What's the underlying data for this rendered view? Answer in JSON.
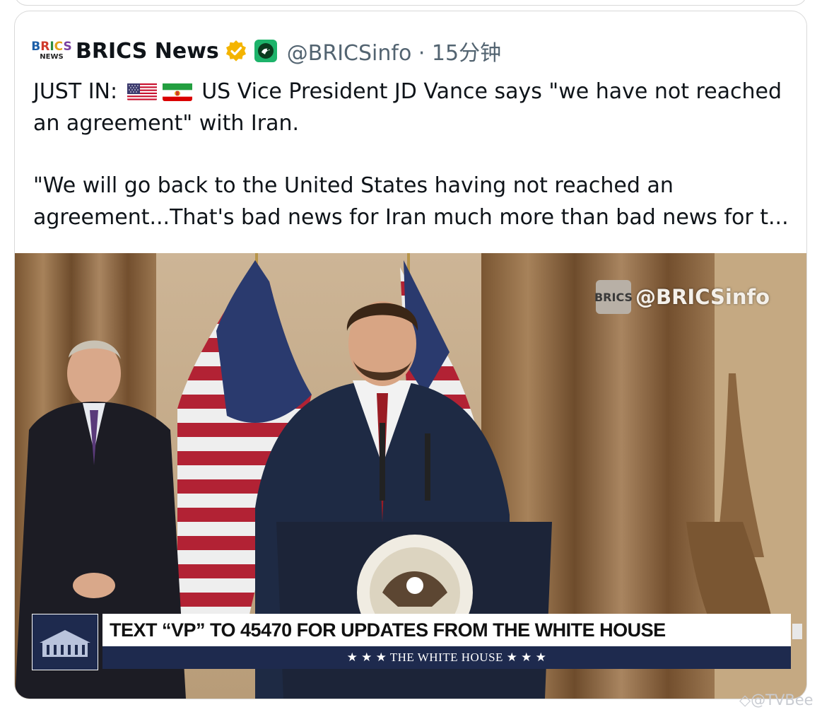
{
  "tweet": {
    "logo": {
      "line1": "BRICS",
      "line2": "NEWS"
    },
    "display_name": "BRICS News",
    "handle_time": "@BRICSinfo · 15分钟",
    "text_line1_prefix": "JUST IN:",
    "text_line1_suffix": "US Vice President JD Vance says \"we have not reached",
    "text_line2": "an agreement\" with Iran.",
    "text_line3": "\"We will go back to the United States having not reached an",
    "text_line4": "agreement...That's bad news for Iran much more than bad news for t..."
  },
  "media": {
    "watermark_logo": "BRICS",
    "watermark_handle": "@BRICSinfo",
    "lower_third_headline": "TEXT “VP” TO 45470 FOR UPDATES FROM THE WHITE HOUSE",
    "lower_third_sub": "★ ★ ★   THE WHITE HOUSE   ★ ★ ★"
  },
  "footer": {
    "watermark": "@TVBee"
  },
  "icons": [
    "verified-badge-icon",
    "affiliate-badge-icon",
    "us-flag-icon",
    "iran-flag-icon",
    "white-house-icon"
  ],
  "colors": {
    "text": "#0f1419",
    "secondary": "#536471",
    "border": "#d9d9d9",
    "navy": "#1e2a4e",
    "verified": "#f4b400"
  }
}
